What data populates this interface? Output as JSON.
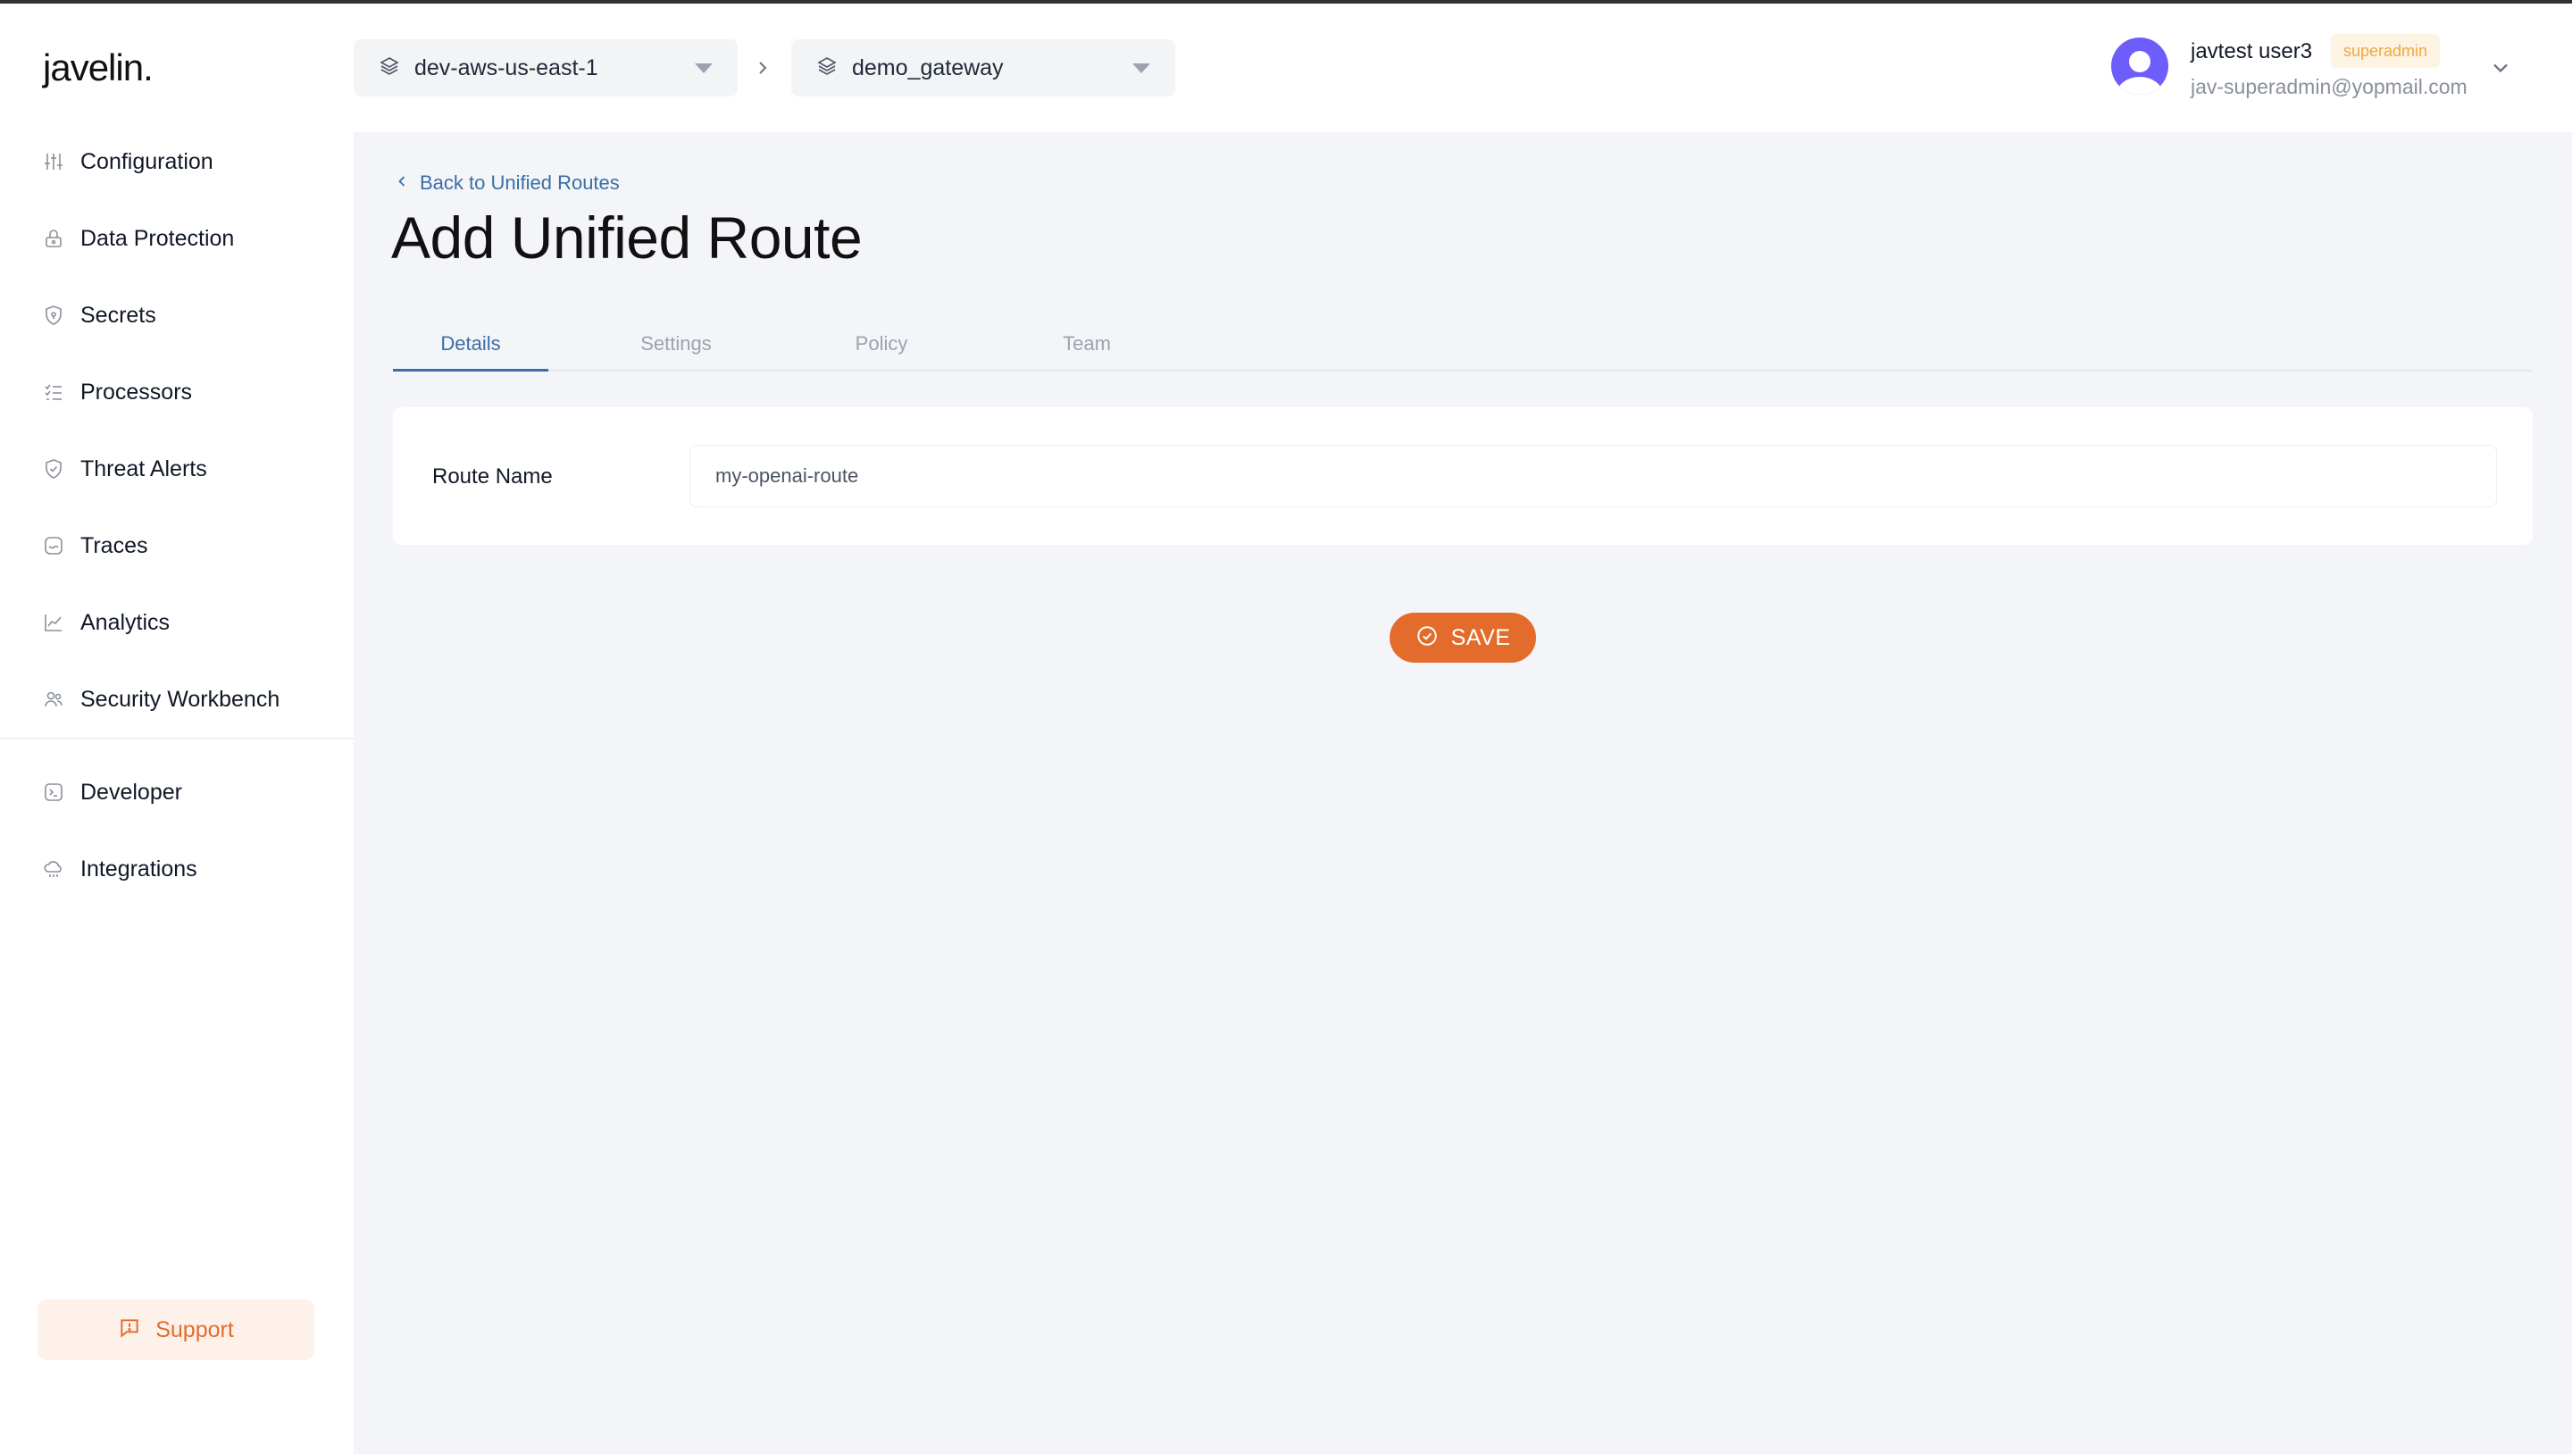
{
  "app": {
    "logo": "javelin."
  },
  "sidebar": {
    "items": [
      {
        "label": "Configuration",
        "icon": "sliders-icon"
      },
      {
        "label": "Data Protection",
        "icon": "lock-icon"
      },
      {
        "label": "Secrets",
        "icon": "shield-icon"
      },
      {
        "label": "Processors",
        "icon": "checklist-icon"
      },
      {
        "label": "Threat Alerts",
        "icon": "shield-check-icon"
      },
      {
        "label": "Traces",
        "icon": "trace-icon"
      },
      {
        "label": "Analytics",
        "icon": "chart-line-icon"
      },
      {
        "label": "Security Workbench",
        "icon": "users-icon"
      },
      {
        "label": "Developer",
        "icon": "terminal-icon"
      },
      {
        "label": "Integrations",
        "icon": "cloud-icon"
      }
    ],
    "support_label": "Support"
  },
  "header": {
    "environment": "dev-aws-us-east-1",
    "gateway": "demo_gateway",
    "user": {
      "name": "javtest user3",
      "role": "superadmin",
      "email": "jav-superadmin@yopmail.com"
    }
  },
  "main": {
    "back_label": "Back to Unified Routes",
    "title": "Add Unified Route",
    "tabs": [
      {
        "label": "Details",
        "active": true
      },
      {
        "label": "Settings",
        "active": false
      },
      {
        "label": "Policy",
        "active": false
      },
      {
        "label": "Team",
        "active": false
      }
    ],
    "form": {
      "route_name_label": "Route Name",
      "route_name_value": "my-openai-route"
    },
    "save_label": "SAVE"
  },
  "colors": {
    "accent": "#e36c2d",
    "link": "#3b6ea5",
    "background": "#f3f5f8",
    "avatar": "#6d5dfb",
    "badge_text": "#f0a63e"
  }
}
